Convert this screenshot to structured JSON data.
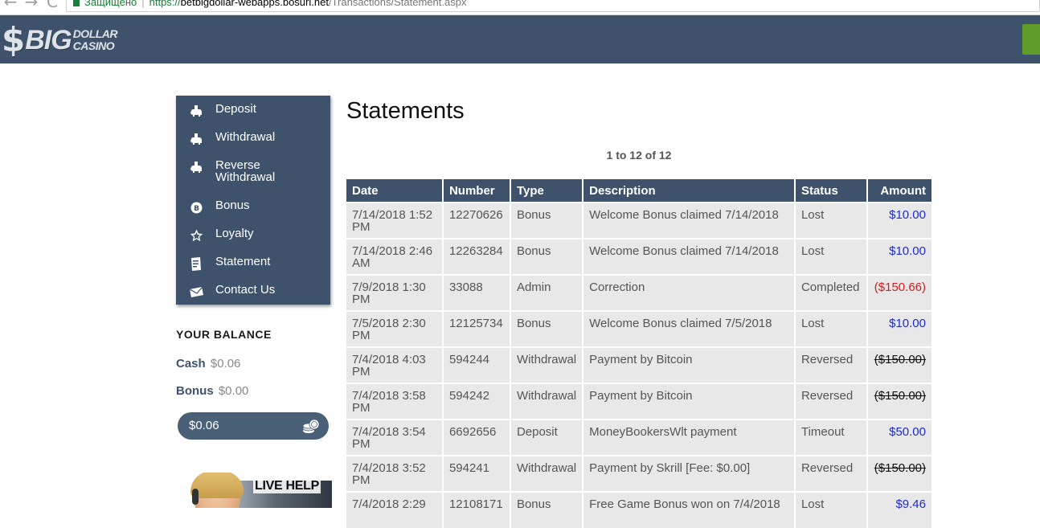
{
  "browser": {
    "nav_back": "←",
    "nav_forward": "→",
    "nav_reload": "C",
    "secure_label": "Защищено",
    "url_scheme": "https://",
    "url_host": "betbigdollar-webapps.bosurl.net",
    "url_path": "/Transactions/Statement.aspx"
  },
  "header": {
    "logo_symbol": "$",
    "logo_big": "BIG",
    "logo_line1": "DOLLAR",
    "logo_line2": "CASINO"
  },
  "menu": {
    "items": [
      {
        "label": "Deposit",
        "icon": "piggy-bank-icon"
      },
      {
        "label": "Withdrawal",
        "icon": "piggy-bank-icon"
      },
      {
        "label": "Reverse Withdrawal",
        "icon": "piggy-bank-icon"
      },
      {
        "label": "Bonus",
        "icon": "bonus-coin-icon"
      },
      {
        "label": "Loyalty",
        "icon": "star-icon"
      },
      {
        "label": "Statement",
        "icon": "document-icon"
      },
      {
        "label": "Contact Us",
        "icon": "envelope-icon"
      }
    ]
  },
  "balance": {
    "title": "YOUR BALANCE",
    "cash_label": "Cash",
    "cash_value": "$0.06",
    "bonus_label": "Bonus",
    "bonus_value": "$0.00",
    "total": "$0.06"
  },
  "live_help": {
    "label": "LIVE HELP"
  },
  "statements": {
    "title": "Statements",
    "pager": "1 to 12 of 12",
    "columns": [
      "Date",
      "Number",
      "Type",
      "Description",
      "Status",
      "Amount"
    ],
    "rows": [
      {
        "date": "7/14/2018 1:52 PM",
        "number": "12270626",
        "type": "Bonus",
        "description": "Welcome Bonus claimed 7/14/2018",
        "status": "Lost",
        "amount": "$10.00",
        "kind": "pos"
      },
      {
        "date": "7/14/2018 2:46 AM",
        "number": "12263284",
        "type": "Bonus",
        "description": "Welcome Bonus claimed 7/14/2018",
        "status": "Lost",
        "amount": "$10.00",
        "kind": "pos"
      },
      {
        "date": "7/9/2018 1:30 PM",
        "number": "33088",
        "type": "Admin",
        "description": "Correction",
        "status": "Completed",
        "amount": "($150.66)",
        "kind": "neg"
      },
      {
        "date": "7/5/2018 2:30 PM",
        "number": "12125734",
        "type": "Bonus",
        "description": "Welcome Bonus claimed 7/5/2018",
        "status": "Lost",
        "amount": "$10.00",
        "kind": "pos"
      },
      {
        "date": "7/4/2018 4:03 PM",
        "number": "594244",
        "type": "Withdrawal",
        "description": "Payment by Bitcoin",
        "status": "Reversed",
        "amount": "($150.00)",
        "kind": "rev"
      },
      {
        "date": "7/4/2018 3:58 PM",
        "number": "594242",
        "type": "Withdrawal",
        "description": "Payment by Bitcoin",
        "status": "Reversed",
        "amount": "($150.00)",
        "kind": "rev"
      },
      {
        "date": "7/4/2018 3:54 PM",
        "number": "6692656",
        "type": "Deposit",
        "description": "MoneyBookersWlt payment",
        "status": "Timeout",
        "amount": "$50.00",
        "kind": "pos"
      },
      {
        "date": "7/4/2018 3:52 PM",
        "number": "594241",
        "type": "Withdrawal",
        "description": "Payment by Skrill [Fee: $0.00]",
        "status": "Reversed",
        "amount": "($150.00)",
        "kind": "rev"
      },
      {
        "date": "7/4/2018 2:29",
        "number": "12108171",
        "type": "Bonus",
        "description": "Free Game Bonus won on 7/4/2018",
        "status": "Lost",
        "amount": "$9.46",
        "kind": "pos"
      }
    ]
  },
  "colors": {
    "header_bg": "#3e536b",
    "amount_positive": "#1d2bd0",
    "amount_negative": "#d41a1a"
  }
}
